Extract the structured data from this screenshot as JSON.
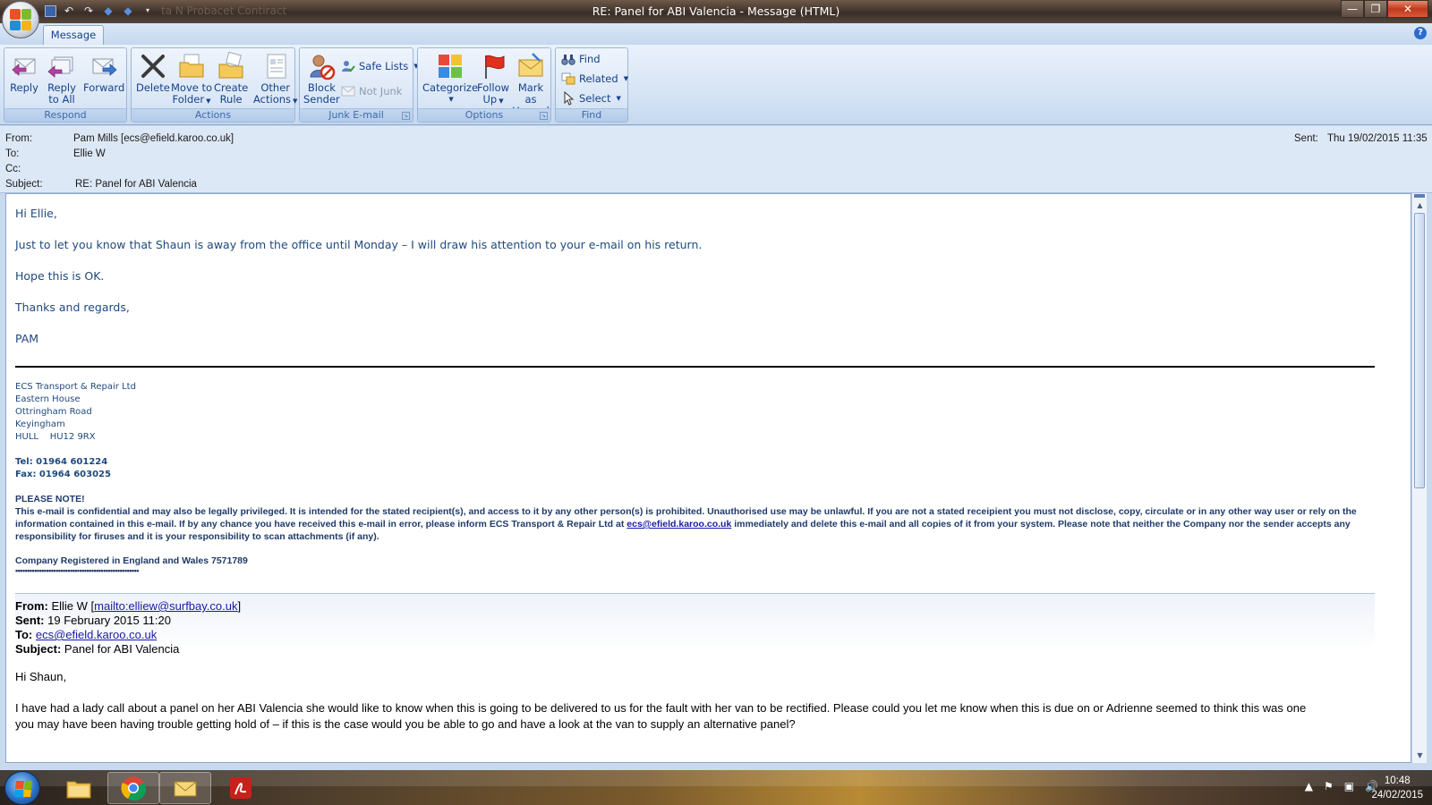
{
  "window": {
    "title": "RE: Panel for ABI Valencia - Message (HTML)",
    "qat_ghost": "ta N  Probacet Contiract",
    "controls": {
      "minimize": "—",
      "maximize": "❐",
      "close": "✕"
    }
  },
  "ribbon": {
    "tab": "Message",
    "groups": {
      "respond": {
        "label": "Respond",
        "reply": "Reply",
        "reply_all_1": "Reply",
        "reply_all_2": "to All",
        "forward": "Forward"
      },
      "actions": {
        "label": "Actions",
        "delete": "Delete",
        "move_1": "Move to",
        "move_2": "Folder",
        "rule_1": "Create",
        "rule_2": "Rule",
        "other_1": "Other",
        "other_2": "Actions"
      },
      "junk": {
        "label": "Junk E-mail",
        "block_1": "Block",
        "block_2": "Sender",
        "safe_lists": "Safe Lists",
        "not_junk": "Not Junk"
      },
      "options": {
        "label": "Options",
        "categorize": "Categorize",
        "follow_1": "Follow",
        "follow_2": "Up",
        "mark_1": "Mark as",
        "mark_2": "Unread"
      },
      "find": {
        "label": "Find",
        "find": "Find",
        "related": "Related",
        "select": "Select"
      }
    }
  },
  "header": {
    "from_label": "From:",
    "from_value": "Pam Mills [ecs@efield.karoo.co.uk]",
    "to_label": "To:",
    "to_value": "Ellie W",
    "cc_label": "Cc:",
    "cc_value": "",
    "subject_label": "Subject:",
    "subject_value": "RE: Panel for ABI Valencia",
    "sent_label": "Sent:",
    "sent_value": "Thu 19/02/2015 11:35"
  },
  "reply": {
    "greeting": "Hi Ellie,",
    "line1": "Just to let you know that Shaun is away from the office until Monday – I will draw his attention to your e-mail on his return.",
    "line2": "Hope this is OK.",
    "line3": "Thanks and regards,",
    "signoff": "PAM"
  },
  "signature": {
    "company": "ECS Transport & Repair Ltd",
    "addr1": "Eastern House",
    "addr2": "Ottringham Road",
    "addr3": "Keyingham",
    "addr4": "HULL    HU12 9RX",
    "tel": "Tel: 01964 601224",
    "fax": "Fax: 01964 603025",
    "notice_title": "PLEASE NOTE!",
    "notice_1": "This e-mail is confidential and may also be legally privileged.  It is intended for the stated recipient(s), and access to it by any other person(s) is prohibited.  Unauthorised use may be unlawful.  If you are not a stated receipient you must not disclose, copy, circulate or in any other way user or rely on the information contained in this e-mail.  If by any chance you have received this e-mail in error, please inform ECS Transport & Repair Ltd at ",
    "notice_email": "ecs@efield.karoo.co.uk",
    "notice_2": " immediately and delete this e-mail and all copies of it from your system.  Please note that neither the Company nor the sender accepts any responsibility for firuses and it is your responsibility to scan attachments (if any).",
    "registered": "Company Registered in England and Wales 7571789",
    "dots": "••••••••••••••••••••••••••••••••••••••••••••••••••••"
  },
  "original": {
    "from_label": "From:",
    "from_name": "Ellie W [",
    "from_link": "mailto:elliew@surfbay.co.uk",
    "from_close": "]",
    "sent_label": "Sent:",
    "sent_value": "19 February 2015 11:20",
    "to_label": "To:",
    "to_link": "ecs@efield.karoo.co.uk",
    "subject_label": "Subject:",
    "subject_value": "Panel for ABI Valencia",
    "greeting": "Hi Shaun,",
    "body_1": "I have had a lady call about a panel on her ABI Valencia she would like to know when this is going to be delivered to us for the fault with her van to be rectified. Please could you let me know when this is due on or Adrienne seemed to think this was one",
    "body_2": "you  may have been having trouble getting hold of – if this is the case would you be able to go and have a look at the van to supply an alternative panel?"
  },
  "taskbar": {
    "time": "10:48",
    "date": "24/02/2015"
  }
}
